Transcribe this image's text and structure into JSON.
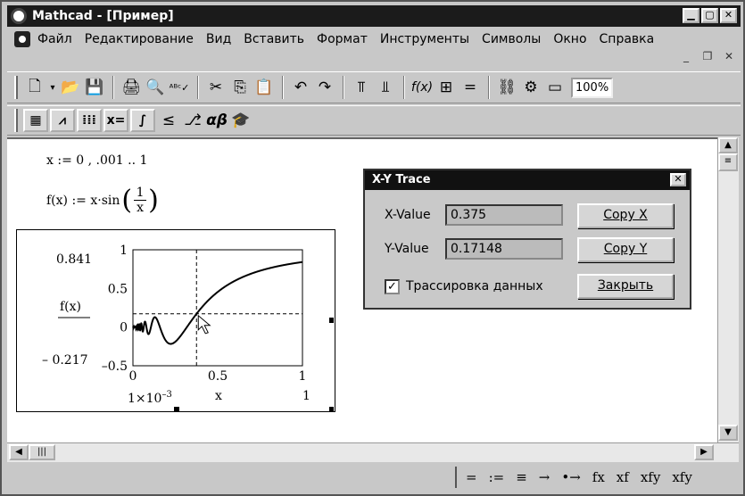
{
  "window": {
    "title": "Mathcad - [Пример]"
  },
  "menu": [
    "Файл",
    "Редактирование",
    "Вид",
    "Вставить",
    "Формат",
    "Инструменты",
    "Символы",
    "Окно",
    "Справка"
  ],
  "zoom": "100%",
  "worksheet": {
    "eq1": "x := 0 , .001 .. 1",
    "eq2_lhs": "f(x) := x·sin",
    "eq2_num": "1",
    "eq2_den": "x"
  },
  "graph": {
    "ytop": "0.841",
    "ybottom": "– 0.217",
    "ylabel": "f(x)",
    "xleft": "1×10",
    "xleft_exp": "–3",
    "xright": "1",
    "xlabel": "x",
    "yticks": [
      "1",
      "0.5",
      "0",
      "–0.5"
    ],
    "xticks": [
      "0",
      "0.5",
      "1"
    ]
  },
  "chart_data": {
    "type": "line",
    "function": "f(x) = x·sin(1/x)",
    "x_range": [
      0.001,
      1
    ],
    "xlim": [
      0,
      1
    ],
    "ylim": [
      -0.5,
      1
    ],
    "trace_point": {
      "x": 0.375,
      "y": 0.17148
    },
    "grid": false
  },
  "trace": {
    "title": "X-Y Trace",
    "xlabel": "X-Value",
    "xvalue": "0.375",
    "ylabel": "Y-Value",
    "yvalue": "0.17148",
    "copyx": "Copy X",
    "copyy": "Copy Y",
    "checkbox_label": "Трассировка данных",
    "checkbox_checked": true,
    "close": "Закрыть"
  },
  "status": [
    "=",
    ":=",
    "≡",
    "→",
    "•→",
    "fx",
    "xf",
    "xfy",
    "xfy"
  ]
}
